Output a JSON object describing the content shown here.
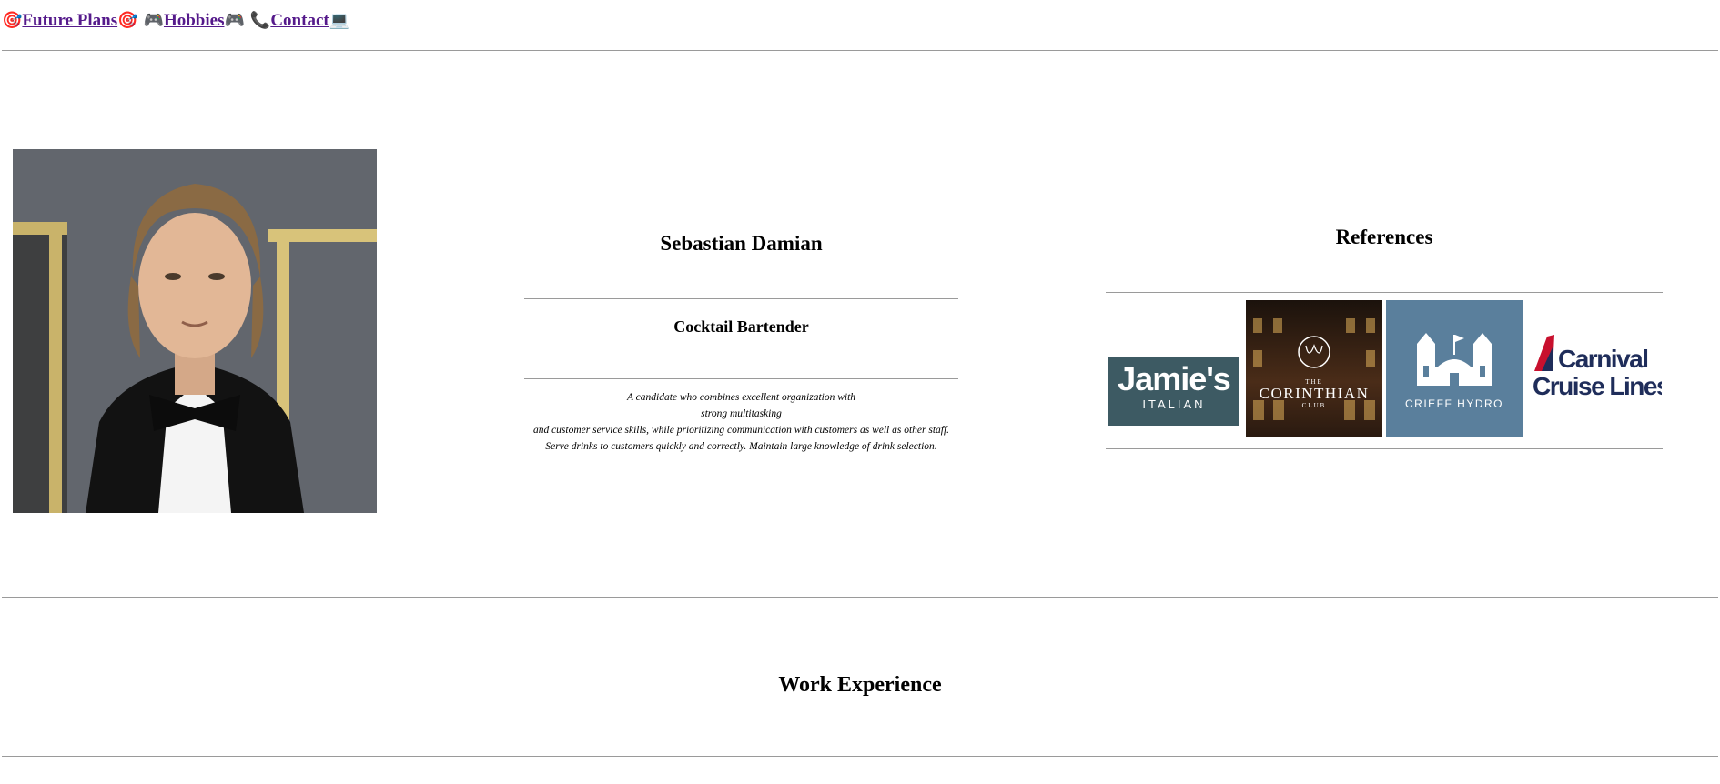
{
  "nav": {
    "items": [
      {
        "icon_left": "🎯",
        "label": "Future Plans",
        "icon_right": "🎯",
        "icon_name": "target-icon"
      },
      {
        "icon_left": "🎮",
        "label": "Hobbies",
        "icon_right": "🎮",
        "icon_name": "gamepad-icon"
      },
      {
        "icon_left": "📞",
        "label": "Contact",
        "icon_right": "💻",
        "icon_name": "phone-icon"
      }
    ]
  },
  "profile": {
    "name": "Sebastian Damian",
    "role": "Cocktail Bartender",
    "summary_lines": [
      "A candidate who combines excellent organization with",
      "strong multitasking",
      "and customer service skills, while prioritizing communication with customers as well as other staff.",
      "Serve drinks to customers quickly and correctly. Maintain large knowledge of drink selection."
    ]
  },
  "references": {
    "title": "References",
    "logos": {
      "jamie": {
        "line1": "Jamie's",
        "line2": "ITALIAN"
      },
      "corinthian": {
        "line1": "THE",
        "line2": "CORINTHIAN",
        "line3": "CLUB"
      },
      "crieff": {
        "line1": "CRIEFF HYDRO"
      },
      "carnival": {
        "line1": "Carnival",
        "line2": "Cruise Lines"
      }
    }
  },
  "sections": {
    "work_title": "Work Experience"
  },
  "colors": {
    "link": "#551a8b",
    "divider": "#9a9a9a",
    "jamie_bg": "#3d5a63",
    "crieff_bg": "#5a7f9c",
    "carnival_red": "#c8102e",
    "carnival_blue": "#1f2d5a"
  }
}
